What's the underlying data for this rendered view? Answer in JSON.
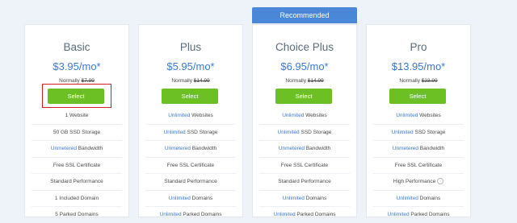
{
  "badge": {
    "recommended": "Recommended"
  },
  "plans": [
    {
      "name": "Basic",
      "price": "$3.95/mo*",
      "normally_prefix": "Normally ",
      "normally_price": "$7.99",
      "select_label": "Select",
      "features": [
        {
          "hl": "",
          "text": "1 Website"
        },
        {
          "hl": "",
          "text": "50 GB SSD Storage"
        },
        {
          "hl": "Unmetered",
          "text": " Bandwidth"
        },
        {
          "hl": "",
          "text": "Free SSL Certificate"
        },
        {
          "hl": "",
          "text": "Standard Performance"
        },
        {
          "hl": "",
          "text": "1 Included Domain"
        },
        {
          "hl": "",
          "text": "5 Parked Domains"
        }
      ]
    },
    {
      "name": "Plus",
      "price": "$5.95/mo*",
      "normally_prefix": "Normally ",
      "normally_price": "$14.99",
      "select_label": "Select",
      "features": [
        {
          "hl": "Unlimited",
          "text": " Websites"
        },
        {
          "hl": "Unlimited",
          "text": " SSD Storage"
        },
        {
          "hl": "Unmetered",
          "text": " Bandwidth"
        },
        {
          "hl": "",
          "text": "Free SSL Certificate"
        },
        {
          "hl": "",
          "text": "Standard Performance"
        },
        {
          "hl": "Unlimited",
          "text": " Domains"
        },
        {
          "hl": "Unlimited",
          "text": " Parked Domains"
        }
      ]
    },
    {
      "name": "Choice Plus",
      "price": "$6.95/mo*",
      "normally_prefix": "Normally ",
      "normally_price": "$14.99",
      "select_label": "Select",
      "features": [
        {
          "hl": "Unlimited",
          "text": " Websites"
        },
        {
          "hl": "Unlimited",
          "text": " SSD Storage"
        },
        {
          "hl": "Unmetered",
          "text": " Bandwidth"
        },
        {
          "hl": "",
          "text": "Free SSL Certificate"
        },
        {
          "hl": "",
          "text": "Standard Performance"
        },
        {
          "hl": "Unlimited",
          "text": " Domains"
        },
        {
          "hl": "Unlimited",
          "text": " Parked Domains"
        }
      ]
    },
    {
      "name": "Pro",
      "price": "$13.95/mo*",
      "normally_prefix": "Normally ",
      "normally_price": "$23.99",
      "select_label": "Select",
      "features": [
        {
          "hl": "Unlimited",
          "text": " Websites"
        },
        {
          "hl": "Unlimited",
          "text": " SSD Storage"
        },
        {
          "hl": "Unmetered",
          "text": " Bandwidth"
        },
        {
          "hl": "",
          "text": "Free SSL Certificate"
        },
        {
          "hl": "",
          "text": "High Performance",
          "info_icon": "info-icon"
        },
        {
          "hl": "Unlimited",
          "text": " Domains"
        },
        {
          "hl": "Unlimited",
          "text": " Parked Domains"
        }
      ]
    }
  ],
  "colors": {
    "accent_blue": "#3a79d0",
    "select_green": "#6cc024",
    "highlight_red": "#d21e1e",
    "recommended_bg": "#4a87d6"
  }
}
